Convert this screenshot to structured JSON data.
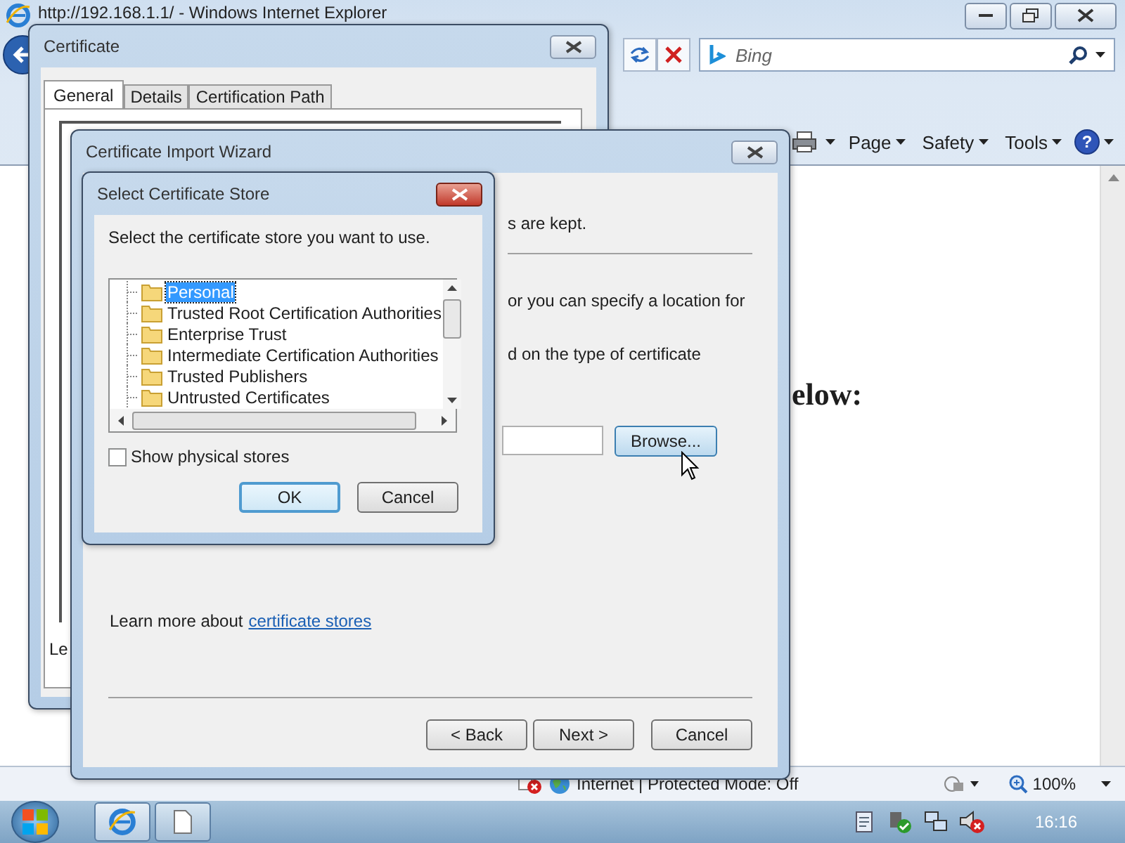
{
  "browser": {
    "title": "http://192.168.1.1/ - Windows Internet Explorer",
    "search": {
      "placeholder": "Bing"
    },
    "command_bar": [
      {
        "label": "Page"
      },
      {
        "label": "Safety"
      },
      {
        "label": "Tools"
      }
    ],
    "help_label": "?",
    "page_heading": "elow:",
    "status_bar": {
      "zone": "Internet | Protected Mode: Off",
      "zoom": "100%"
    }
  },
  "certificate_dialog": {
    "title": "Certificate",
    "tabs": [
      {
        "label": "General",
        "selected": true
      },
      {
        "label": "Details",
        "selected": false
      },
      {
        "label": "Certification Path",
        "selected": false
      }
    ],
    "body_text": "Le"
  },
  "import_wizard": {
    "title": "Certificate Import Wizard",
    "text_lines": [
      "s are kept.",
      "or you can specify a location for",
      "d on the type of certificate"
    ],
    "browse_button": "Browse...",
    "learn_more": {
      "text": "Learn more about",
      "link": "certificate stores"
    },
    "buttons": [
      "< Back",
      "Next >",
      "Cancel"
    ]
  },
  "store_dialog": {
    "title": "Select Certificate Store",
    "prompt": "Select the certificate store you want to use.",
    "stores": [
      {
        "label": "Personal",
        "selected": true
      },
      {
        "label": "Trusted Root Certification Authorities",
        "selected": false
      },
      {
        "label": "Enterprise Trust",
        "selected": false
      },
      {
        "label": "Intermediate Certification Authorities",
        "selected": false
      },
      {
        "label": "Trusted Publishers",
        "selected": false
      },
      {
        "label": "Untrusted Certificates",
        "selected": false
      }
    ],
    "show_physical_stores": {
      "label": "Show physical stores",
      "checked": false
    },
    "buttons": [
      "OK",
      "Cancel"
    ]
  },
  "taskbar": {
    "clock": "16:16"
  }
}
